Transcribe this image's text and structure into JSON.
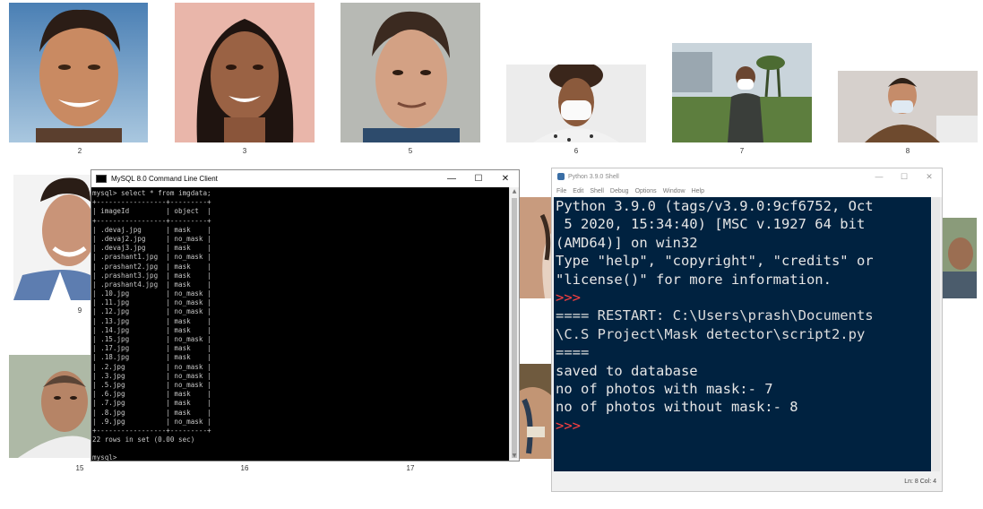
{
  "gallery": {
    "captions": [
      "2",
      "3",
      "5",
      "6",
      "7",
      "8",
      "9",
      "15",
      "16",
      "17"
    ]
  },
  "mysql_window": {
    "title": "MySQL 8.0 Command Line Client",
    "controls": [
      "—",
      "☐",
      "✕"
    ],
    "lines": [
      "mysql> select * from imgdata;",
      "+-----------------+---------+",
      "| imageId         | object  |",
      "+-----------------+---------+",
      "| .devaj.jpg      | mask    |",
      "| .devaj2.jpg     | no_mask |",
      "| .devaj3.jpg     | mask    |",
      "| .prashant1.jpg  | no_mask |",
      "| .prashant2.jpg  | mask    |",
      "| .prashant3.jpg  | mask    |",
      "| .prashant4.jpg  | mask    |",
      "| .10.jpg         | no_mask |",
      "| .11.jpg         | no_mask |",
      "| .12.jpg         | no_mask |",
      "| .13.jpg         | mask    |",
      "| .14.jpg         | mask    |",
      "| .15.jpg         | no_mask |",
      "| .17.jpg         | mask    |",
      "| .18.jpg         | mask    |",
      "| .2.jpg          | no_mask |",
      "| .3.jpg          | no_mask |",
      "| .5.jpg          | no_mask |",
      "| .6.jpg          | mask    |",
      "| .7.jpg          | mask    |",
      "| .8.jpg          | mask    |",
      "| .9.jpg          | no_mask |",
      "+-----------------+---------+",
      "22 rows in set (0.00 sec)",
      "",
      "mysql> "
    ]
  },
  "python_window": {
    "title": "Python 3.9.0 Shell",
    "controls": [
      "—",
      "☐",
      "✕"
    ],
    "menu": [
      "File",
      "Edit",
      "Shell",
      "Debug",
      "Options",
      "Window",
      "Help"
    ],
    "colors": {
      "output": "#e6e6e6",
      "prompt": "#ff4040",
      "restart": "#dddddd",
      "background": "#002240"
    },
    "lines": [
      {
        "text": "Python 3.9.0 (tags/v3.9.0:9cf6752, Oct",
        "kind": "output"
      },
      {
        "text": " 5 2020, 15:34:40) [MSC v.1927 64 bit",
        "kind": "output"
      },
      {
        "text": "(AMD64)] on win32",
        "kind": "output"
      },
      {
        "text": "Type \"help\", \"copyright\", \"credits\" or",
        "kind": "output"
      },
      {
        "text": "\"license()\" for more information.",
        "kind": "output"
      },
      {
        "text": ">>>",
        "kind": "prompt"
      },
      {
        "text": "==== RESTART: C:\\Users\\prash\\Documents",
        "kind": "restart"
      },
      {
        "text": "\\C.S Project\\Mask detector\\script2.py",
        "kind": "restart"
      },
      {
        "text": "====",
        "kind": "restart"
      },
      {
        "text": "saved to database",
        "kind": "output"
      },
      {
        "text": "no of photos with mask:- 7",
        "kind": "output"
      },
      {
        "text": "no of photos without mask:- 8",
        "kind": "output"
      },
      {
        "text": ">>>",
        "kind": "prompt"
      }
    ],
    "status": "Ln: 8   Col: 4"
  }
}
